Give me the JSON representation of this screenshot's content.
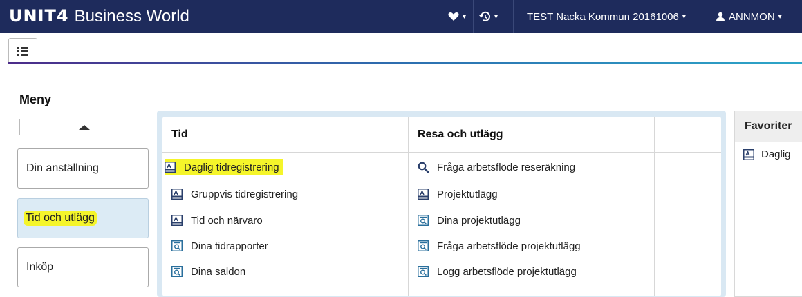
{
  "header": {
    "logo_mark": "UNIT4",
    "logo_text": "Business World",
    "favorites_icon": "heart-icon",
    "history_icon": "history-icon",
    "company": "TEST Nacka Kommun 20161006",
    "user": "ANNMON"
  },
  "page": {
    "title": "Meny"
  },
  "categories": [
    {
      "label": "Din anställning"
    },
    {
      "label": "Tid och utlägg"
    },
    {
      "label": "Inköp"
    }
  ],
  "columns": [
    {
      "heading": "Tid",
      "items": [
        {
          "label": "Daglig tidregistrering",
          "icon": "form-icon"
        },
        {
          "label": "Gruppvis tidregistrering",
          "icon": "form-icon"
        },
        {
          "label": "Tid och närvaro",
          "icon": "form-icon"
        },
        {
          "label": "Dina tidrapporter",
          "icon": "report-icon"
        },
        {
          "label": "Dina saldon",
          "icon": "report-icon"
        }
      ]
    },
    {
      "heading": "Resa och utlägg",
      "items": [
        {
          "label": "Fråga arbetsflöde reseräkning",
          "icon": "search-icon"
        },
        {
          "label": "Projektutlägg",
          "icon": "form-icon"
        },
        {
          "label": "Dina projektutlägg",
          "icon": "report-icon"
        },
        {
          "label": "Fråga arbetsflöde projektutlägg",
          "icon": "report-icon"
        },
        {
          "label": "Logg arbetsflöde projektutlägg",
          "icon": "report-icon"
        }
      ]
    }
  ],
  "favorites": {
    "heading": "Favoriter",
    "items": [
      {
        "label": "Daglig",
        "icon": "form-icon"
      }
    ]
  },
  "colors": {
    "topbar": "#1e2b5c",
    "highlight": "#f5f52a",
    "active_category": "#dcebf5"
  }
}
